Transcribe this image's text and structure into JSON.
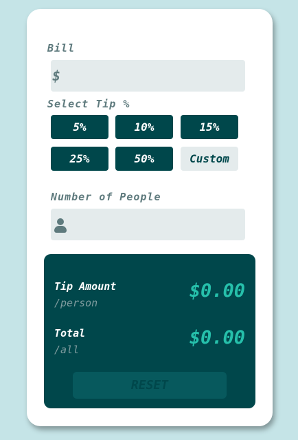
{
  "bill": {
    "label": "Bill",
    "currency_symbol": "$",
    "value": ""
  },
  "tip": {
    "label": "Select Tip %",
    "options": [
      "5%",
      "10%",
      "15%",
      "25%",
      "50%"
    ],
    "custom_label": "Custom"
  },
  "people": {
    "label": "Number of People",
    "value": ""
  },
  "results": {
    "tip_amount": {
      "title": "Tip Amount",
      "sub": "/person",
      "value": "$0.00"
    },
    "total": {
      "title": "Total",
      "sub": "/all",
      "value": "$0.00"
    },
    "reset_label": "RESET"
  },
  "colors": {
    "background": "#c5e4e7",
    "dark_cyan": "#00474b",
    "accent": "#26c0ab",
    "input_bg": "#e4ebec",
    "label_gray": "#5e7a7d"
  }
}
